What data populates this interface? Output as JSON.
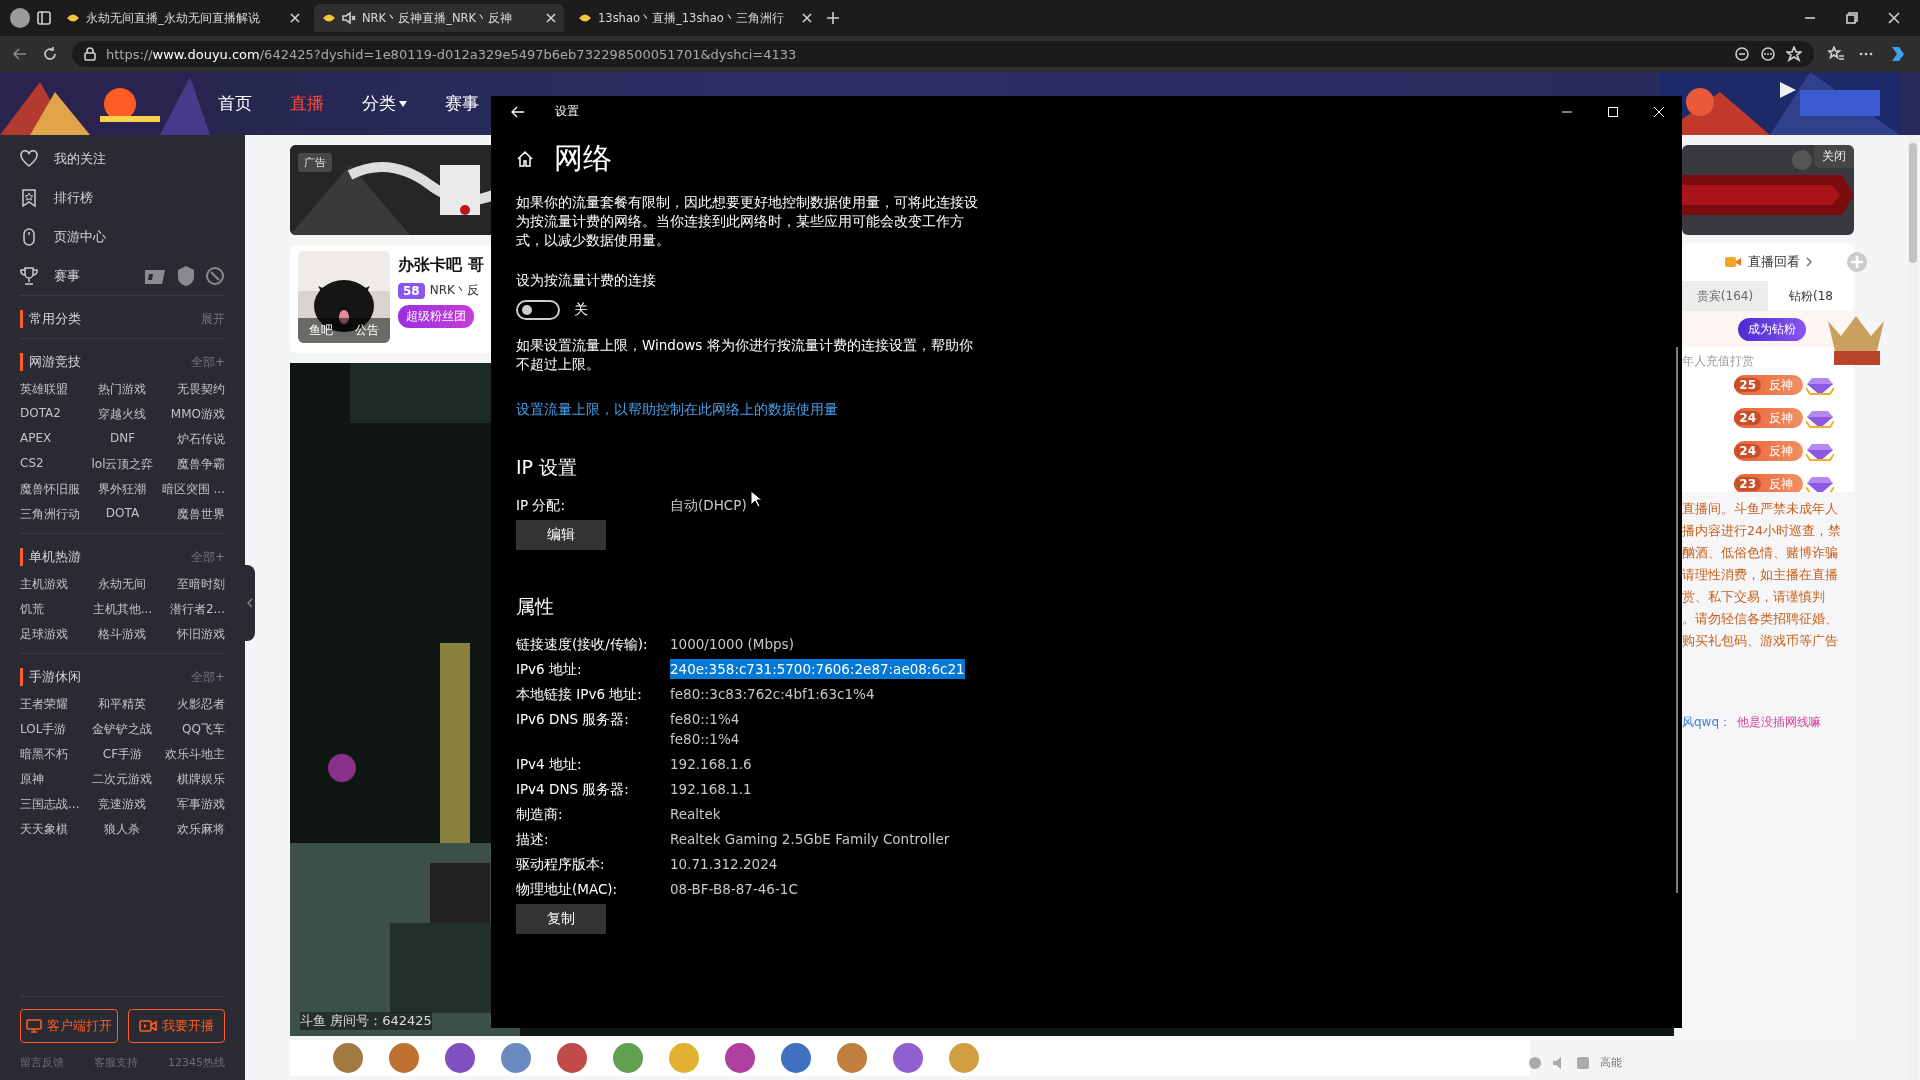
{
  "browser": {
    "tabs": [
      {
        "title": "永劫无间直播_永劫无间直播解说",
        "muted": false,
        "selected": false
      },
      {
        "title": "NRK丶反神直播_NRK丶反神",
        "muted": true,
        "selected": true
      },
      {
        "title": "13shao丶直播_13shao丶三角洲行",
        "muted": false,
        "selected": false
      }
    ],
    "url": "https://**www.douyu.com**/642425?dyshid=1e80119-d012a329e5497b6eb732298500051701&dyshci=4133"
  },
  "site_header": {
    "nav": [
      {
        "label": "首页",
        "selected": false
      },
      {
        "label": "直播",
        "selected": true
      },
      {
        "label": "分类",
        "selected": false,
        "dropdown": true
      },
      {
        "label": "赛事",
        "selected": false
      }
    ]
  },
  "sidebar": {
    "nav": [
      {
        "label": "我的关注",
        "kind": "heart"
      },
      {
        "label": "排行榜",
        "kind": "rank"
      },
      {
        "label": "页游中心",
        "kind": "mouse"
      },
      {
        "label": "赛事",
        "kind": "trophy"
      }
    ],
    "sections": [
      {
        "title": "常用分类",
        "action": "展开"
      },
      {
        "title": "网游竞技",
        "action": "全部+",
        "items": [
          "英雄联盟",
          "热门游戏",
          "无畏契约",
          "DOTA2",
          "穿越火线",
          "MMO游戏",
          "APEX",
          "DNF",
          "炉石传说",
          "CS2",
          "lol云顶之弈",
          "魔兽争霸",
          "魔兽怀旧服",
          "界外狂潮",
          "暗区突围 ...",
          "三角洲行动",
          "DOTA",
          "魔兽世界"
        ]
      },
      {
        "title": "单机热游",
        "action": "全部+",
        "items": [
          "主机游戏",
          "永劫无间",
          "至暗时刻",
          "饥荒",
          "主机其他...",
          "潜行者2...",
          "足球游戏",
          "格斗游戏",
          "怀旧游戏"
        ]
      },
      {
        "title": "手游休闲",
        "action": "全部+",
        "items": [
          "王者荣耀",
          "和平精英",
          "火影忍者",
          "LOL手游",
          "金铲铲之战",
          "QQ飞车",
          "暗黑不朽",
          "CF手游",
          "欢乐斗地主",
          "原神",
          "二次元游戏",
          "棋牌娱乐",
          "三国志战...",
          "竞速游戏",
          "军事游戏",
          "天天象棋",
          "狼人杀",
          "欢乐麻将"
        ]
      }
    ],
    "buttons": [
      {
        "label": "客户端打开",
        "kind": "monitor"
      },
      {
        "label": "我要开播",
        "kind": "camera"
      }
    ],
    "footer_links": [
      "留言反馈",
      "客服支持",
      "12345热线"
    ]
  },
  "stream": {
    "ad_label": "广告",
    "avatar_links": [
      "鱼吧",
      "公告"
    ],
    "title": "办张卡吧 哥",
    "level": "58",
    "streamer": "NRK丶反",
    "fan_club": "超级粉丝团",
    "room_id": "斗鱼 房间号：642425"
  },
  "settings_window": {
    "title": "设置",
    "heading": "网络",
    "intro": "如果你的流量套餐有限制，因此想要更好地控制数据使用量，可将此连接设为按流量计费的网络。当你连接到此网络时，某些应用可能会改变工作方式，以减少数据使用量。",
    "metered": {
      "label": "设为按流量计费的连接",
      "on": false,
      "state_text": "关"
    },
    "limit_note": "如果设置流量上限，Windows 将为你进行按流量计费的连接设置，帮助你不超过上限。",
    "limit_link": "设置流量上限，以帮助控制在此网络上的数据使用量",
    "ip_settings": {
      "heading": "IP 设置",
      "rows": [
        {
          "label": "IP 分配:",
          "values": [
            "自动(DHCP)"
          ],
          "selected": false
        }
      ],
      "button": "编辑"
    },
    "properties": {
      "heading": "属性",
      "rows": [
        {
          "label": "链接速度(接收/传输):",
          "values": [
            "1000/1000 (Mbps)"
          ],
          "selected": false
        },
        {
          "label": "IPv6 地址:",
          "values": [
            "240e:358:c731:5700:7606:2e87:ae08:6c21"
          ],
          "selected": true
        },
        {
          "label": "本地链接 IPv6 地址:",
          "values": [
            "fe80::3c83:762c:4bf1:63c1%4"
          ],
          "selected": false
        },
        {
          "label": "IPv6 DNS 服务器:",
          "values": [
            "fe80::1%4",
            "fe80::1%4"
          ],
          "selected": false
        },
        {
          "label": "IPv4 地址:",
          "values": [
            "192.168.1.6"
          ],
          "selected": false
        },
        {
          "label": "IPv4 DNS 服务器:",
          "values": [
            "192.168.1.1"
          ],
          "selected": false
        },
        {
          "label": "制造商:",
          "values": [
            "Realtek"
          ],
          "selected": false
        },
        {
          "label": "描述:",
          "values": [
            "Realtek Gaming 2.5GbE Family Controller"
          ],
          "selected": false
        },
        {
          "label": "驱动程序版本:",
          "values": [
            "10.71.312.2024"
          ],
          "selected": false
        },
        {
          "label": "物理地址(MAC):",
          "values": [
            "08-BF-B8-87-46-1C"
          ],
          "selected": false
        }
      ],
      "button": "复制"
    }
  },
  "right_panel": {
    "close": "关闭",
    "replay": "直播回看",
    "tabs": [
      {
        "label": "贵宾(164)",
        "selected": false
      },
      {
        "label": "钻粉(18",
        "selected": true
      }
    ],
    "join_badge": "成为钻粉",
    "rank_note": "年人充值打赏",
    "fans": [
      {
        "level": "25",
        "name": "反神"
      },
      {
        "level": "24",
        "name": "反神"
      },
      {
        "level": "24",
        "name": "反神"
      },
      {
        "level": "23",
        "name": "反神"
      }
    ],
    "notice_lines": [
      "直播间。斗鱼严禁未成年人",
      "播内容进行24小时巡查，禁",
      "酗酒、低俗色情、赌博诈骗",
      "请理性消费，如主播在直播",
      "赏、私下交易，请谨慎判",
      "。请勿轻信各类招聘征婚、",
      "购买礼包码、游戏币等广告"
    ],
    "chat": [
      {
        "user": "风qwq：",
        "text": "他是没插网线嘛"
      }
    ],
    "toolbar_label": "高能"
  }
}
